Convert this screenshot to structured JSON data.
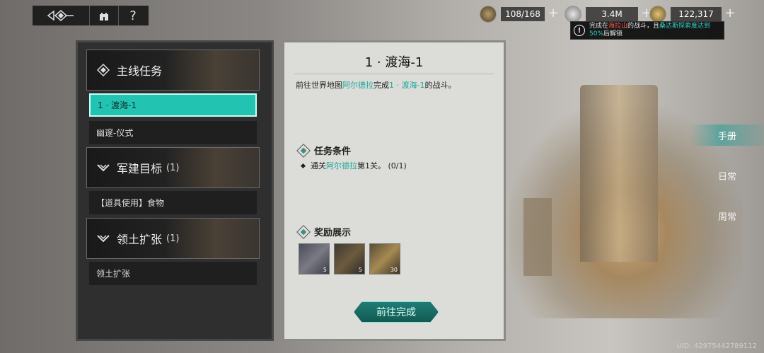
{
  "topbar": {
    "help": "?"
  },
  "resources": [
    {
      "value": "108/168",
      "plus": "+"
    },
    {
      "value": "3.4M",
      "plus": "+"
    },
    {
      "value": "122,317",
      "plus": "+"
    }
  ],
  "tooltip": {
    "part1": "完成在",
    "place": "海拉山",
    "part2": "的战斗，且",
    "place2": "桑达斯探索度达到",
    "percent": "50%",
    "part3": "后解锁"
  },
  "left": {
    "cat_main": "主线任务",
    "item_active": "1 · 渡海-1",
    "item2": "幽邃-仪式",
    "cat_build": "军建目标",
    "cat_build_count": "(1)",
    "item3": "【道具使用】食物",
    "cat_terr": "领土扩张",
    "cat_terr_count": "(1)",
    "item4": "领土扩张"
  },
  "center": {
    "title": "1 · 渡海-1",
    "desc_pre": "前往世界地图",
    "desc_place": "阿尔德拉",
    "desc_mid": "完成",
    "desc_quest": "1 · 渡海-1",
    "desc_post": "的战斗。",
    "cond_header": "任务条件",
    "cond_pre": "通关",
    "cond_place": "阿尔德拉",
    "cond_post": "第1关。 (0/1)",
    "reward_header": "奖励展示",
    "rewards": [
      "5",
      "5",
      "30"
    ],
    "go_button": "前往完成"
  },
  "tabs": [
    "手册",
    "日常",
    "周常"
  ],
  "uid": "UID: 42975442789112"
}
